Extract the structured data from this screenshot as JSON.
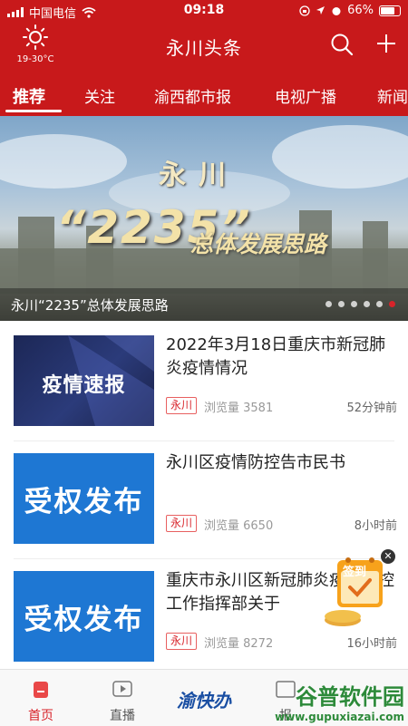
{
  "status_bar": {
    "carrier": "中国电信",
    "time": "09:18",
    "battery": "66%"
  },
  "header": {
    "temperature": "19-30°C",
    "title": "永川头条"
  },
  "tabs": [
    {
      "label": "推荐"
    },
    {
      "label": "关注"
    },
    {
      "label": "渝西都市报"
    },
    {
      "label": "电视广播"
    },
    {
      "label": "新闻"
    }
  ],
  "banner": {
    "art_word": "永川",
    "art_number": "“2235”",
    "art_text": "总体发展思路",
    "caption": "永川“2235”总体发展思路",
    "dot_count": 6,
    "active_dot": 6
  },
  "news": [
    {
      "thumb_text": "疫情速报",
      "title": "2022年3月18日重庆市新冠肺炎疫情情况",
      "tag": "永川",
      "views": "浏览量 3581",
      "time": "52分钟前"
    },
    {
      "thumb_text": "受权发布",
      "title": "永川区疫情防控告市民书",
      "tag": "永川",
      "views": "浏览量 6650",
      "time": "8小时前"
    },
    {
      "thumb_text": "受权发布",
      "title": "重庆市永川区新冠肺炎疫情防控工作指挥部关于",
      "tag": "永川",
      "views": "浏览量 8272",
      "time": "16小时前"
    }
  ],
  "signin": {
    "label": "签到"
  },
  "tabbar": [
    {
      "label": "首页",
      "icon": "home-icon"
    },
    {
      "label": "直播",
      "icon": "play-icon"
    },
    {
      "label": "渝快办",
      "icon": "logo"
    },
    {
      "label": "报",
      "icon": "newspaper-icon"
    },
    {
      "label": "",
      "icon": ""
    }
  ],
  "watermark": {
    "brand": "谷普软件园",
    "url": "www.gupuxiazai.com"
  },
  "colors": {
    "brand_red": "#c8191b",
    "accent_red": "#d8232a",
    "blue": "#1e77d3",
    "dark_navy": "#1c2756"
  }
}
